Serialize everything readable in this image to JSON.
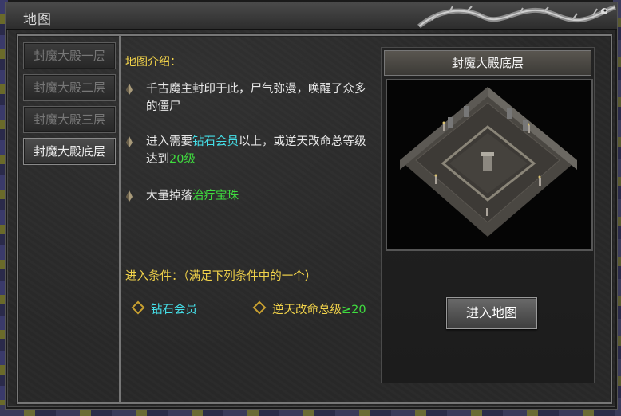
{
  "window": {
    "title": "地图"
  },
  "tabs": [
    {
      "label": "封魔大殿一层",
      "active": false
    },
    {
      "label": "封魔大殿二层",
      "active": false
    },
    {
      "label": "封魔大殿三层",
      "active": false
    },
    {
      "label": "封魔大殿底层",
      "active": true
    }
  ],
  "info": {
    "heading": "地图介绍：",
    "bullet1": "千古魔主封印于此，尸气弥漫，唤醒了众多的僵尸",
    "bullet2": {
      "pre": "进入需要",
      "hl1": "钻石会员",
      "mid": "以上，或逆天改命总等级达到",
      "hl2": "20级"
    },
    "bullet3": {
      "pre": "大量掉落",
      "hl": "治疗宝珠"
    }
  },
  "conditions": {
    "title": "进入条件：（满足下列条件中的一个）",
    "items": [
      {
        "label": "钻石会员",
        "value": ""
      },
      {
        "label": "逆天改命总级",
        "value": "≥20"
      }
    ]
  },
  "preview": {
    "map_name": "封魔大殿底层"
  },
  "actions": {
    "enter_label": "进入地图"
  },
  "colors": {
    "accent_yellow": "#f2d34a",
    "cyan": "#45dfe8",
    "green": "#3fdc3f"
  },
  "icons": {
    "bullet": "bullet-marker-icon",
    "condition": "diamond-icon",
    "ornament": "dragon-ornament-icon"
  }
}
